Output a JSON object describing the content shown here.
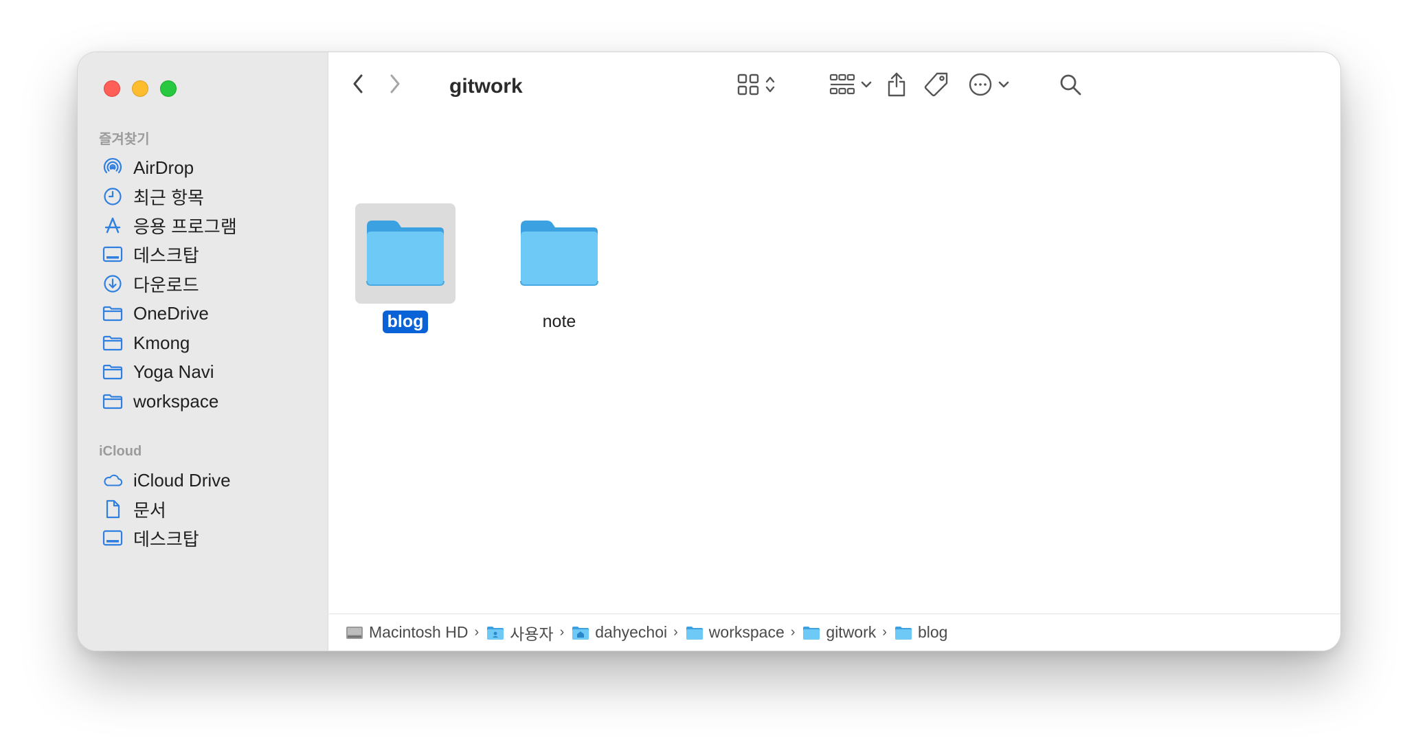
{
  "window": {
    "title": "gitwork",
    "traffic_lights": [
      "close",
      "minimize",
      "zoom"
    ]
  },
  "sidebar": {
    "favorites_title": "즐겨찾기",
    "favorites": [
      {
        "label": "AirDrop",
        "icon": "airdrop-icon"
      },
      {
        "label": "최근 항목",
        "icon": "clock-icon"
      },
      {
        "label": "응용 프로그램",
        "icon": "applications-icon"
      },
      {
        "label": "데스크탑",
        "icon": "desktop-icon"
      },
      {
        "label": "다운로드",
        "icon": "download-icon"
      },
      {
        "label": "OneDrive",
        "icon": "folder-icon"
      },
      {
        "label": "Kmong",
        "icon": "folder-icon"
      },
      {
        "label": "Yoga Navi",
        "icon": "folder-icon"
      },
      {
        "label": "workspace",
        "icon": "folder-icon"
      }
    ],
    "icloud_title": "iCloud",
    "icloud": [
      {
        "label": "iCloud Drive",
        "icon": "cloud-icon"
      },
      {
        "label": "문서",
        "icon": "document-icon"
      },
      {
        "label": "데스크탑",
        "icon": "desktop-icon"
      }
    ]
  },
  "toolbar": {
    "back": "chevron-left-icon",
    "forward": "chevron-right-icon",
    "view_mode": "icon-grid-icon",
    "group_by": "group-grid-icon",
    "share": "share-icon",
    "tag": "tag-icon",
    "more": "ellipsis-circle-icon",
    "search": "search-icon"
  },
  "files": [
    {
      "name": "blog",
      "selected": true
    },
    {
      "name": "note",
      "selected": false
    }
  ],
  "path": [
    {
      "label": "Macintosh HD",
      "icon": "harddrive-icon"
    },
    {
      "label": "사용자",
      "icon": "folder-icon"
    },
    {
      "label": "dahyechoi",
      "icon": "home-folder-icon"
    },
    {
      "label": "workspace",
      "icon": "folder-icon"
    },
    {
      "label": "gitwork",
      "icon": "folder-icon"
    },
    {
      "label": "blog",
      "icon": "folder-icon"
    }
  ],
  "colors": {
    "accent": "#0a63d6",
    "sidebar_icon": "#2f7fe0",
    "folder_light": "#6ec9f7",
    "folder_dark": "#3ba1e0"
  }
}
